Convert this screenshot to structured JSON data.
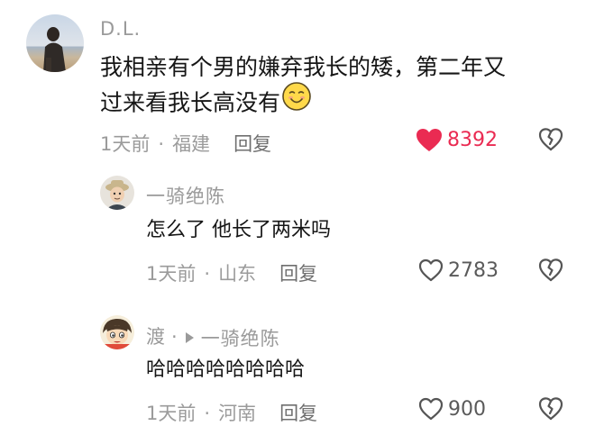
{
  "comments": [
    {
      "username": "D.L.",
      "text_line1": "我相亲有个男的嫌弃我长的矮，第二年又",
      "text_line2": "过来看我长高没有",
      "emoji": "smiling-face-emoji",
      "time": "1天前",
      "location": "福建",
      "reply_label": "回复",
      "likes": "8392",
      "liked": true,
      "accent_color": "#ea2b52"
    }
  ],
  "replies": [
    {
      "username": "一骑绝陈",
      "text": "怎么了 他长了两米吗",
      "time": "1天前",
      "location": "山东",
      "reply_label": "回复",
      "likes": "2783",
      "liked": false
    },
    {
      "username": "渡",
      "reply_to": "一骑绝陈",
      "text": "哈哈哈哈哈哈哈哈",
      "time": "1天前",
      "location": "河南",
      "reply_label": "回复",
      "likes": "900",
      "liked": false
    }
  ],
  "separator": "·"
}
